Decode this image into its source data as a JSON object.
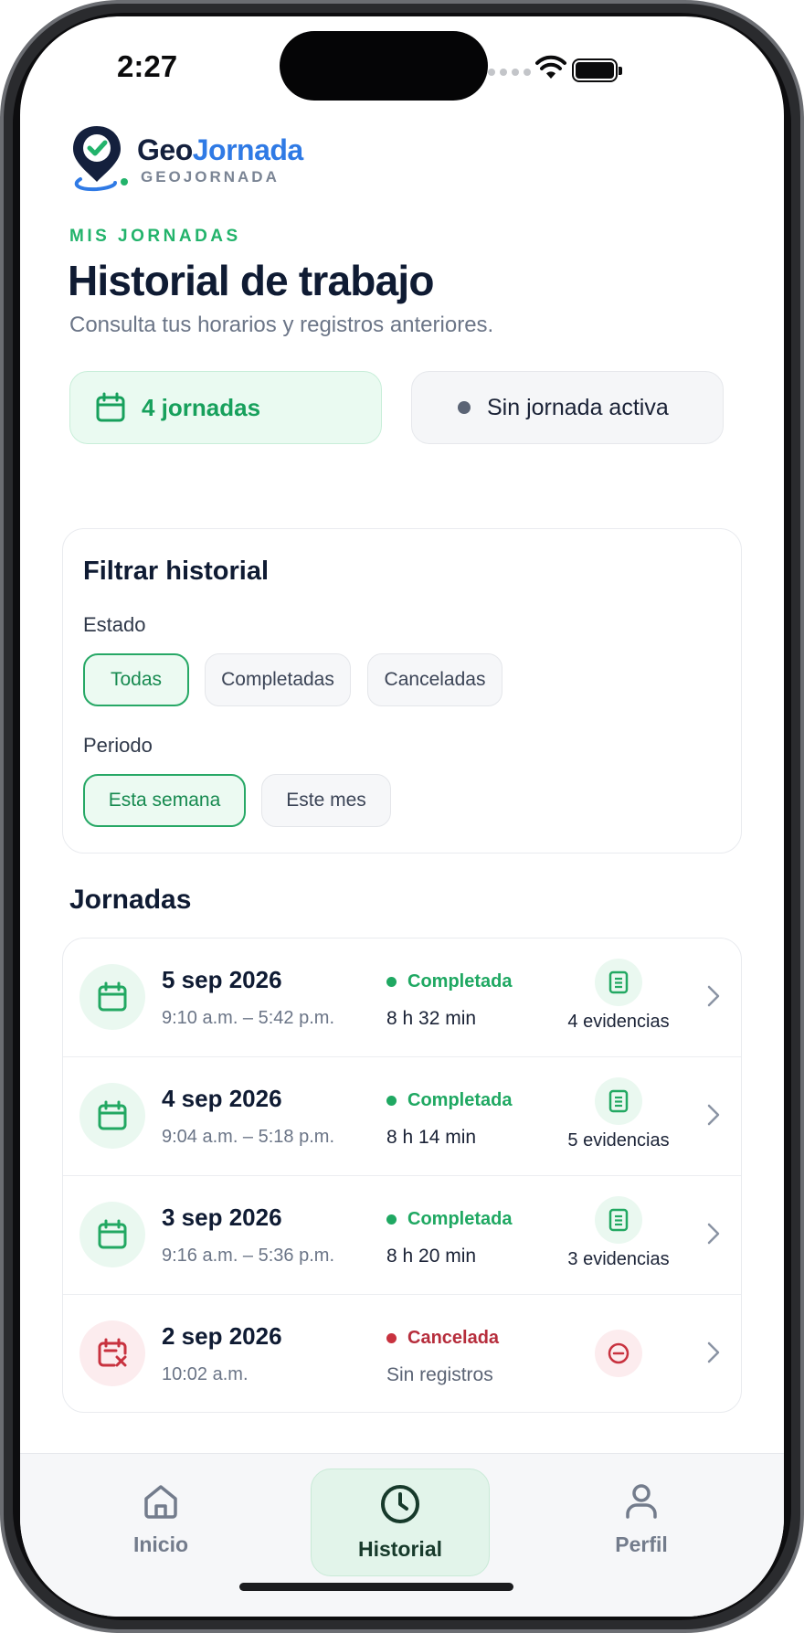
{
  "status_bar": {
    "time": "2:27"
  },
  "logo": {
    "title_part1": "Geo",
    "title_part2": "Jornada",
    "subtitle": "GEOJORNADA"
  },
  "header": {
    "eyebrow": "MIS JORNADAS",
    "title": "Historial de trabajo",
    "subtitle": "Consulta tus horarios y registros anteriores."
  },
  "summary": {
    "count_label": "4 jornadas",
    "active_label": "Sin jornada activa"
  },
  "filters": {
    "title": "Filtrar historial",
    "estado_label": "Estado",
    "estado_options": [
      "Todas",
      "Completadas",
      "Canceladas"
    ],
    "estado_selected": "Todas",
    "periodo_label": "Periodo",
    "periodo_options": [
      "Esta semana",
      "Este mes"
    ],
    "periodo_selected": "Esta semana"
  },
  "list": {
    "title": "Jornadas",
    "items": [
      {
        "date": "5 sep 2026",
        "time": "9:10 a.m. – 5:42 p.m.",
        "status": "Completada",
        "duration": "8 h 32 min",
        "evidence": "4 evidencias"
      },
      {
        "date": "4 sep 2026",
        "time": "9:04 a.m. – 5:18 p.m.",
        "status": "Completada",
        "duration": "8 h 14 min",
        "evidence": "5 evidencias"
      },
      {
        "date": "3 sep 2026",
        "time": "9:16 a.m. – 5:36 p.m.",
        "status": "Completada",
        "duration": "8 h 20 min",
        "evidence": "3 evidencias"
      },
      {
        "date": "2 sep 2026",
        "time": "10:02 a.m.",
        "status": "Cancelada",
        "duration": "Sin registros",
        "evidence": ""
      }
    ]
  },
  "tabbar": {
    "items": [
      {
        "label": "Inicio",
        "icon": "home-icon"
      },
      {
        "label": "Historial",
        "icon": "clock-icon"
      },
      {
        "label": "Perfil",
        "icon": "user-icon"
      }
    ],
    "active": "Historial"
  },
  "colors": {
    "accent_green": "#22b36b",
    "brand_blue": "#2f7ae5",
    "danger_red": "#c8323f",
    "navy": "#0f1b33"
  }
}
